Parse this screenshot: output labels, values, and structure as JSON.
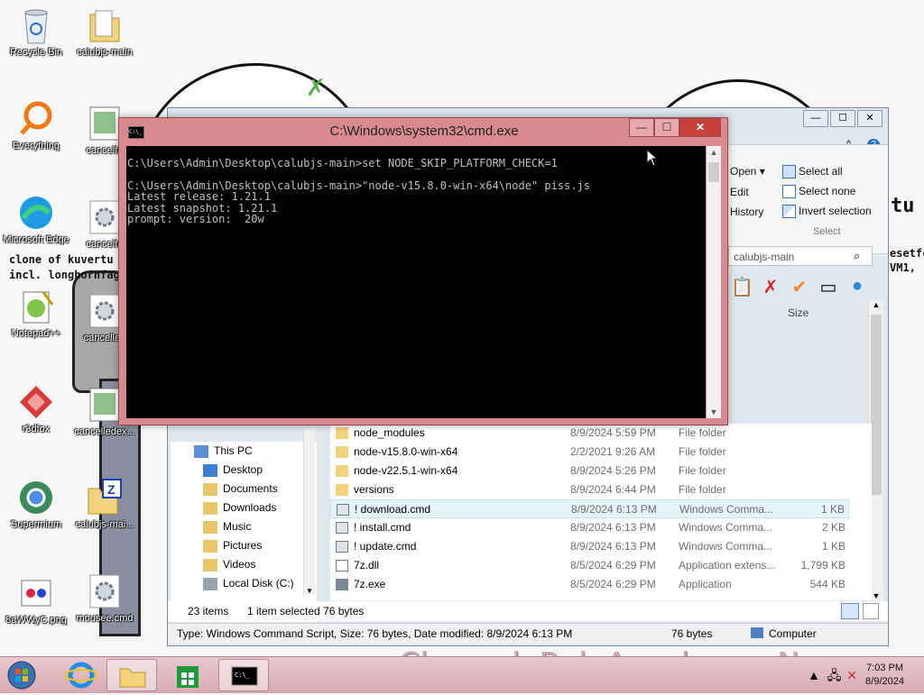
{
  "desktop": {
    "icons": [
      {
        "label": "Recycle Bin",
        "icon": "recycle-bin-icon"
      },
      {
        "label": "calubjs-main",
        "icon": "folder-icon"
      },
      {
        "label": "Everything",
        "icon": "everything-search-icon"
      },
      {
        "label": "cancelfa",
        "icon": "image-file-icon"
      },
      {
        "label": "Microsoft Edge",
        "icon": "edge-icon"
      },
      {
        "label": "cancelfa",
        "icon": "settings-file-icon"
      },
      {
        "label": "Notepad++",
        "icon": "notepadpp-icon"
      },
      {
        "label": "cancelled",
        "icon": "settings-file-icon"
      },
      {
        "label": "r3dfox",
        "icon": "r3dfox-icon"
      },
      {
        "label": "cancelledex...",
        "icon": "image-file-icon"
      },
      {
        "label": "Supermium",
        "icon": "supermium-icon"
      },
      {
        "label": "calubjs-mai...",
        "icon": "zip-folder-icon"
      },
      {
        "label": "8aWWyC.png",
        "icon": "png-file-icon"
      },
      {
        "label": "mousee.cmd",
        "icon": "settings-file-icon"
      }
    ],
    "wallpaper_texts": [
      "clone of kuvertu",
      "incl. longhornfag",
      "tu",
      "esetfc",
      "VM1,"
    ],
    "watermark": "CherrydoBoloAconha on Newgrounds"
  },
  "cmd": {
    "title": "C:\\Windows\\system32\\cmd.exe",
    "lines": [
      "C:\\Users\\Admin\\Desktop\\calubjs-main>set NODE_SKIP_PLATFORM_CHECK=1",
      "",
      "C:\\Users\\Admin\\Desktop\\calubjs-main>\"node-v15.8.0-win-x64\\node\" piss.js",
      "Latest release: 1.21.1",
      "Latest snapshot: 1.21.1",
      "prompt: version:  20w"
    ],
    "minimize": "—",
    "maximize": "☐",
    "close": "✕"
  },
  "explorer": {
    "ribbon": {
      "open": "Open ▾",
      "edit": "Edit",
      "history": "History",
      "select_all": "Select all",
      "select_none": "Select none",
      "invert_selection": "Invert selection",
      "select_group": "Select"
    },
    "search_placeholder": "calubjs-main",
    "size_header": "Size",
    "nav": [
      {
        "label": "This PC",
        "icon": "computer-icon"
      },
      {
        "label": "Desktop",
        "icon": "desktop-folder-icon"
      },
      {
        "label": "Documents",
        "icon": "documents-folder-icon"
      },
      {
        "label": "Downloads",
        "icon": "downloads-folder-icon"
      },
      {
        "label": "Music",
        "icon": "music-folder-icon"
      },
      {
        "label": "Pictures",
        "icon": "pictures-folder-icon"
      },
      {
        "label": "Videos",
        "icon": "videos-folder-icon"
      },
      {
        "label": "Local Disk (C:)",
        "icon": "drive-icon"
      }
    ],
    "files": [
      {
        "name": "node_modules",
        "date": "8/9/2024 5:59 PM",
        "type": "File folder",
        "size": "",
        "icon": "folder-icon"
      },
      {
        "name": "node-v15.8.0-win-x64",
        "date": "2/2/2021 9:26 AM",
        "type": "File folder",
        "size": "",
        "icon": "folder-icon"
      },
      {
        "name": "node-v22.5.1-win-x64",
        "date": "8/9/2024 5:26 PM",
        "type": "File folder",
        "size": "",
        "icon": "folder-icon"
      },
      {
        "name": "versions",
        "date": "8/9/2024 6:44 PM",
        "type": "File folder",
        "size": "",
        "icon": "folder-icon"
      },
      {
        "name": "! download.cmd",
        "date": "8/9/2024 6:13 PM",
        "type": "Windows Comma...",
        "size": "1 KB",
        "icon": "cmd-file-icon"
      },
      {
        "name": "! install.cmd",
        "date": "8/9/2024 6:13 PM",
        "type": "Windows Comma...",
        "size": "2 KB",
        "icon": "cmd-file-icon"
      },
      {
        "name": "! update.cmd",
        "date": "8/9/2024 6:13 PM",
        "type": "Windows Comma...",
        "size": "1 KB",
        "icon": "cmd-file-icon"
      },
      {
        "name": "7z.dll",
        "date": "8/5/2024 6:29 PM",
        "type": "Application extens...",
        "size": "1,799 KB",
        "icon": "dll-file-icon"
      },
      {
        "name": "7z.exe",
        "date": "8/5/2024 6:29 PM",
        "type": "Application",
        "size": "544 KB",
        "icon": "exe-file-icon"
      }
    ],
    "status": {
      "items": "23 items",
      "selected": "1 item selected  76 bytes"
    },
    "details": {
      "info": "Type: Windows Command Script, Size: 76 bytes, Date modified: 8/9/2024 6:13 PM",
      "size": "76 bytes",
      "location": "Computer"
    }
  },
  "taskbar": {
    "time": "7:03 PM",
    "date": "8/9/2024",
    "buttons": [
      "start-button",
      "internet-explorer",
      "file-explorer",
      "store",
      "command-prompt"
    ]
  }
}
